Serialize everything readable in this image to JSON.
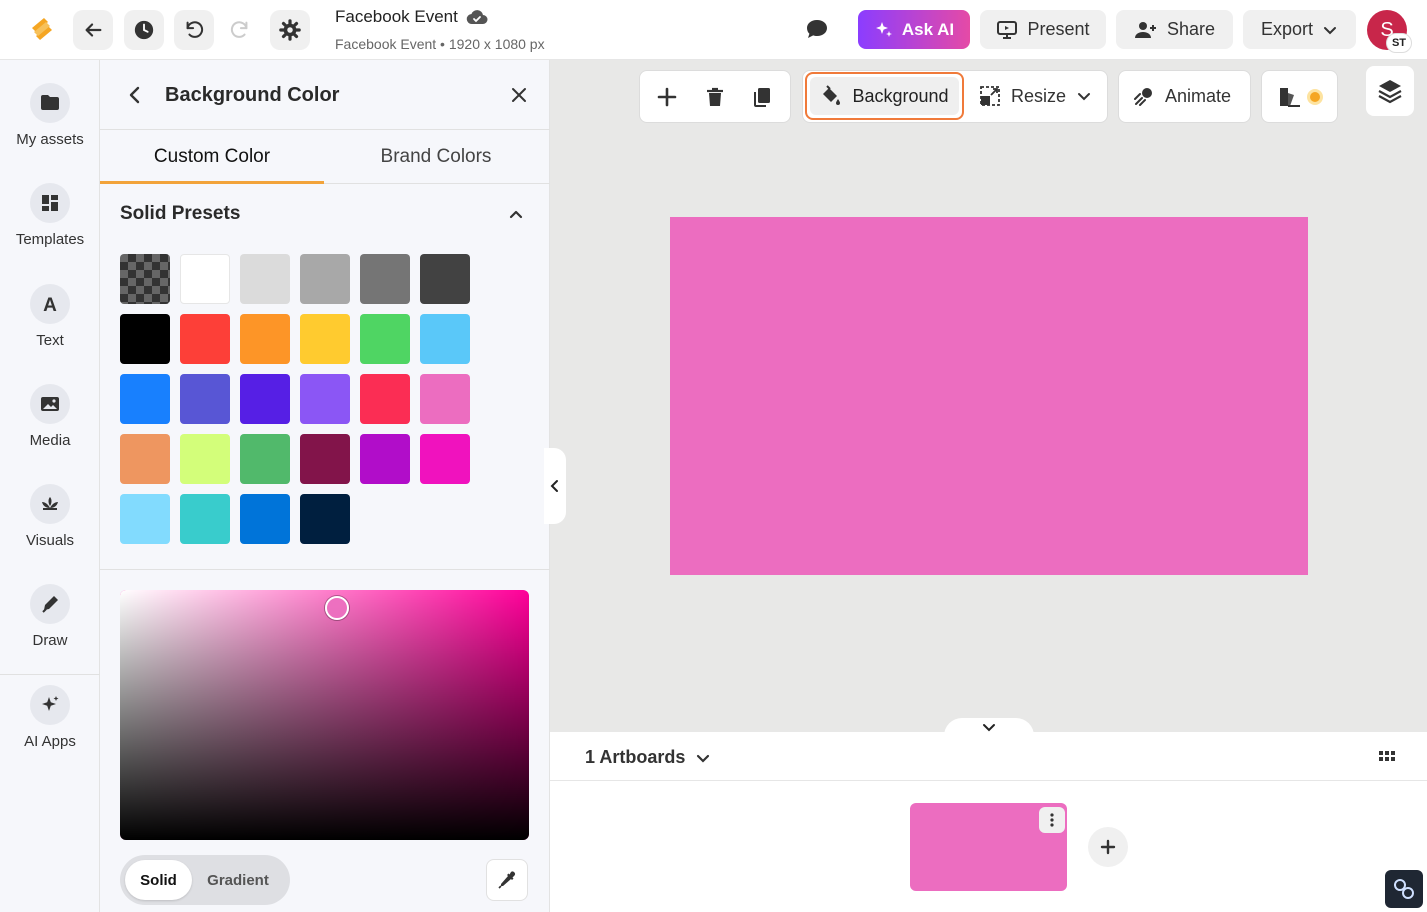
{
  "header": {
    "doc_title": "Facebook Event",
    "doc_subtitle": "Facebook Event • 1920 x 1080 px",
    "ask_ai_label": "Ask AI",
    "present_label": "Present",
    "share_label": "Share",
    "export_label": "Export",
    "avatar_initial": "S",
    "avatar_badge": "ST"
  },
  "rail": {
    "items": [
      {
        "label": "My assets",
        "icon": "folder-icon"
      },
      {
        "label": "Templates",
        "icon": "templates-icon"
      },
      {
        "label": "Text",
        "icon": "text-icon"
      },
      {
        "label": "Media",
        "icon": "image-icon"
      },
      {
        "label": "Visuals",
        "icon": "visuals-icon"
      },
      {
        "label": "Draw",
        "icon": "pen-icon"
      },
      {
        "label": "AI Apps",
        "icon": "sparkle-icon"
      }
    ]
  },
  "panel": {
    "title": "Background Color",
    "tabs": [
      "Custom Color",
      "Brand Colors"
    ],
    "active_tab": "Custom Color",
    "presets_title": "Solid Presets",
    "swatches": [
      "transparent",
      "#FFFFFF",
      "#DBDBDB",
      "#A8A8A8",
      "#757575",
      "#424242",
      "#000000",
      "#FD3F38",
      "#FD9527",
      "#FFCB2F",
      "#4FD563",
      "#5AC8F9",
      "#1880FE",
      "#5856D5",
      "#561FE5",
      "#8B56F5",
      "#FB2D54",
      "#EC6DC0",
      "#EE9660",
      "#D3FE7A",
      "#51B96B",
      "#82144A",
      "#B10DC9",
      "#F012BE",
      "#82DBFE",
      "#39CCCC",
      "#0074D9",
      "#001F3F"
    ],
    "picker_hue": "#FF0099",
    "mode_options": [
      "Solid",
      "Gradient"
    ],
    "active_mode": "Solid"
  },
  "toolbar": {
    "background_label": "Background",
    "resize_label": "Resize",
    "animate_label": "Animate"
  },
  "canvas": {
    "background_color": "#EC6DC0"
  },
  "artboards": {
    "count_label": "1 Artboards"
  },
  "colors": {
    "accent": "#F07A3A",
    "brand_tab_underline": "#F2A33A",
    "ai_gradient_start": "#8B3DFF",
    "ai_gradient_end": "#E54AA6"
  }
}
